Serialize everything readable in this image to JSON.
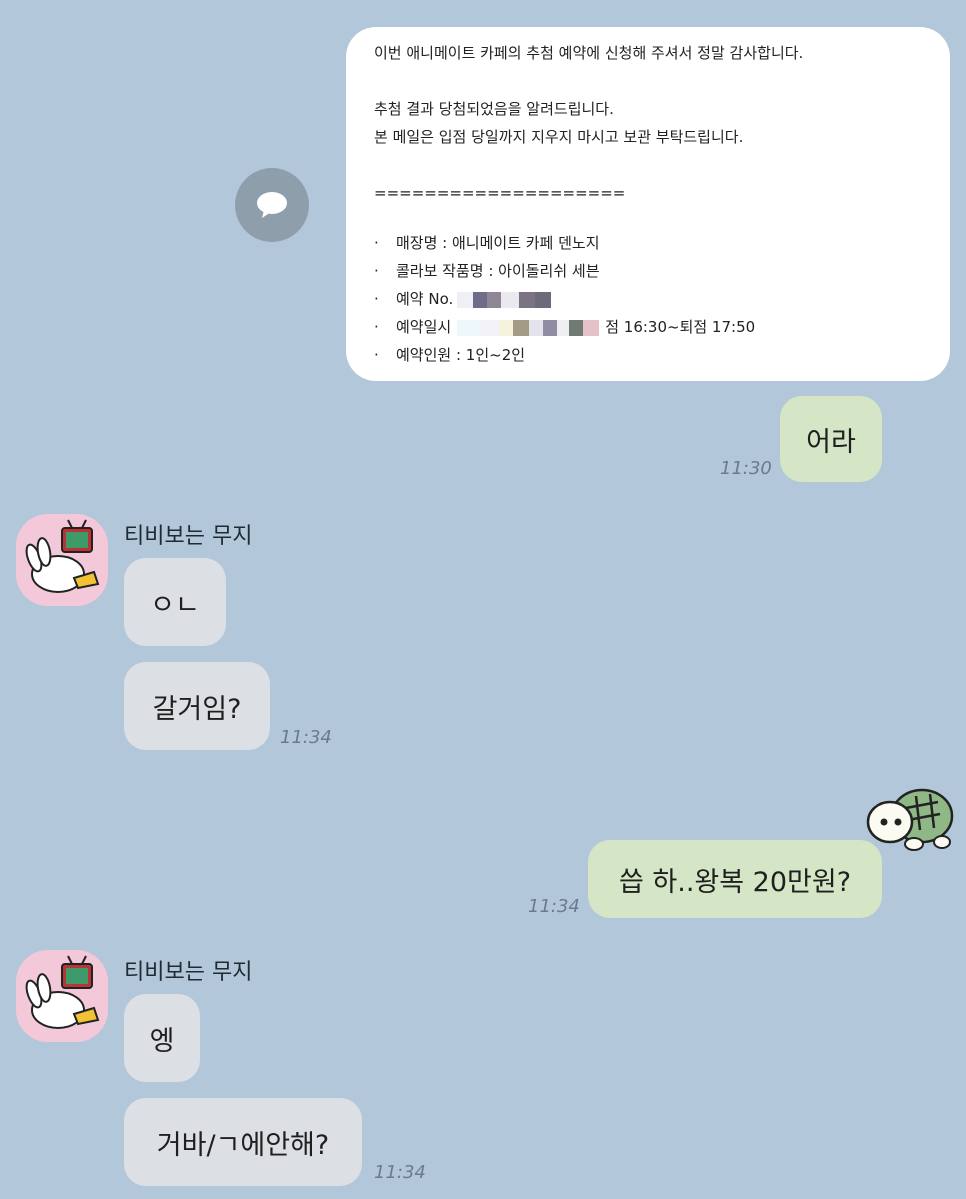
{
  "email": {
    "greeting": "이번 애니메이트 카페의 추첨 예약에 신청해 주셔서 정말 감사합니다.",
    "result_line": "추첨 결과 당첨되었음을 알려드립니다.",
    "keep_line": "본 메일은 입점 당일까지 지우지 마시고 보관 부탁드립니다.",
    "divider": "====================",
    "bullet": "·",
    "store": "매장명 : 애니메이트 카페 덴노지",
    "collab": "콜라보 작품명 : 아이돌리쉬 세븐",
    "reservation_no": "예약 No.",
    "reservation_datetime_label": "예약일시",
    "reservation_datetime_suffix": "점 16:30~퇴점 17:50",
    "party": "예약인원 : 1인~2인"
  },
  "messages": {
    "me1": {
      "text": "어라",
      "time": "11:30"
    },
    "other1": {
      "sender": "티비보는 무지",
      "text1": "ㅇㄴ",
      "text2": "갈거임?",
      "time": "11:34"
    },
    "me2": {
      "text": "씁 하..왕복 20만원?",
      "time": "11:34"
    },
    "other2": {
      "sender": "티비보는 무지",
      "text1": "엥",
      "text2": "거바/ㄱ에안해?",
      "time": "11:34"
    }
  },
  "colors": {
    "background": "#b2c7d9",
    "my_bubble": "#d4e6c6",
    "other_bubble": "#dcdfe3",
    "card": "#ffffff"
  },
  "icons": {
    "share": "speech-bubble-icon",
    "avatar": "muzi-watching-tv-avatar",
    "sticker": "turtle-sticker"
  }
}
